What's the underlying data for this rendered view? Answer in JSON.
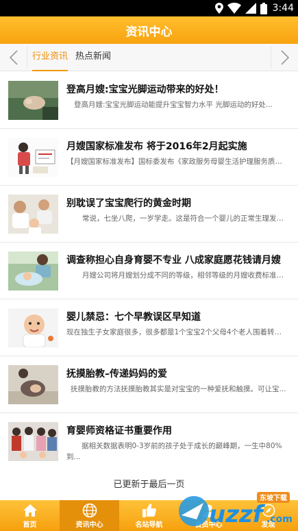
{
  "status_bar": {
    "time": "3:44"
  },
  "header": {
    "title": "资讯中心"
  },
  "tabs": [
    {
      "label": "行业资讯",
      "active": true
    },
    {
      "label": "热点新闻",
      "active": false
    }
  ],
  "articles": [
    {
      "title": "登高月嫂:宝宝光脚运动带来的好处！",
      "summary": "登高月嫂:宝宝光脚运动能提升宝宝智力水平  光脚运动的好处..."
    },
    {
      "title": "月嫂国家标准发布 将于2016年2月起实施",
      "summary": "【月嫂国家标准发布】国标委发布《家政服务母婴生活护理服务质量..."
    },
    {
      "title": "别耽误了宝宝爬行的黄金时期",
      "summary": "常说，七坐八爬，一岁学走。这是符合一个婴儿的正常生理发展..."
    },
    {
      "title": "调查称担心自身育婴不专业 八成家庭愿花钱请月嫂",
      "summary": "月嫂公司将月嫂划分成不同的等级，相邻等级的月嫂收费标准相..."
    },
    {
      "title": "婴儿禁忌：七个早教误区早知道",
      "summary": "现在独生子女家庭很多，很多都是1个宝宝2个父母4个老人围着转。..."
    },
    {
      "title": "抚摸胎教–传递妈妈的爱",
      "summary": "抚摸胎教的方法抚摸胎教其实是对宝宝的一种爱抚和触摸。可让宝..."
    },
    {
      "title": "育婴师资格证书重要作用",
      "summary": "据相关数据表明0-3岁前的孩子处于成长的巅峰期，一生中80%到..."
    }
  ],
  "load_more": "已更新于最后一页",
  "bottom_nav": [
    {
      "label": "首页",
      "icon": "home-icon",
      "active": false
    },
    {
      "label": "资讯中心",
      "icon": "globe-icon",
      "active": true
    },
    {
      "label": "名站导航",
      "icon": "thumbs-up-icon",
      "active": false
    },
    {
      "label": "会员中心",
      "icon": "member-icon",
      "active": false
    },
    {
      "label": "发现",
      "icon": "discover-icon",
      "active": false
    }
  ],
  "watermark": {
    "brand": "uzzf",
    "domain": ".com",
    "tagline": "东坡下载"
  },
  "colors": {
    "accent": "#f8a310",
    "tab_active": "#f08c00",
    "status_bar": "#000000"
  }
}
